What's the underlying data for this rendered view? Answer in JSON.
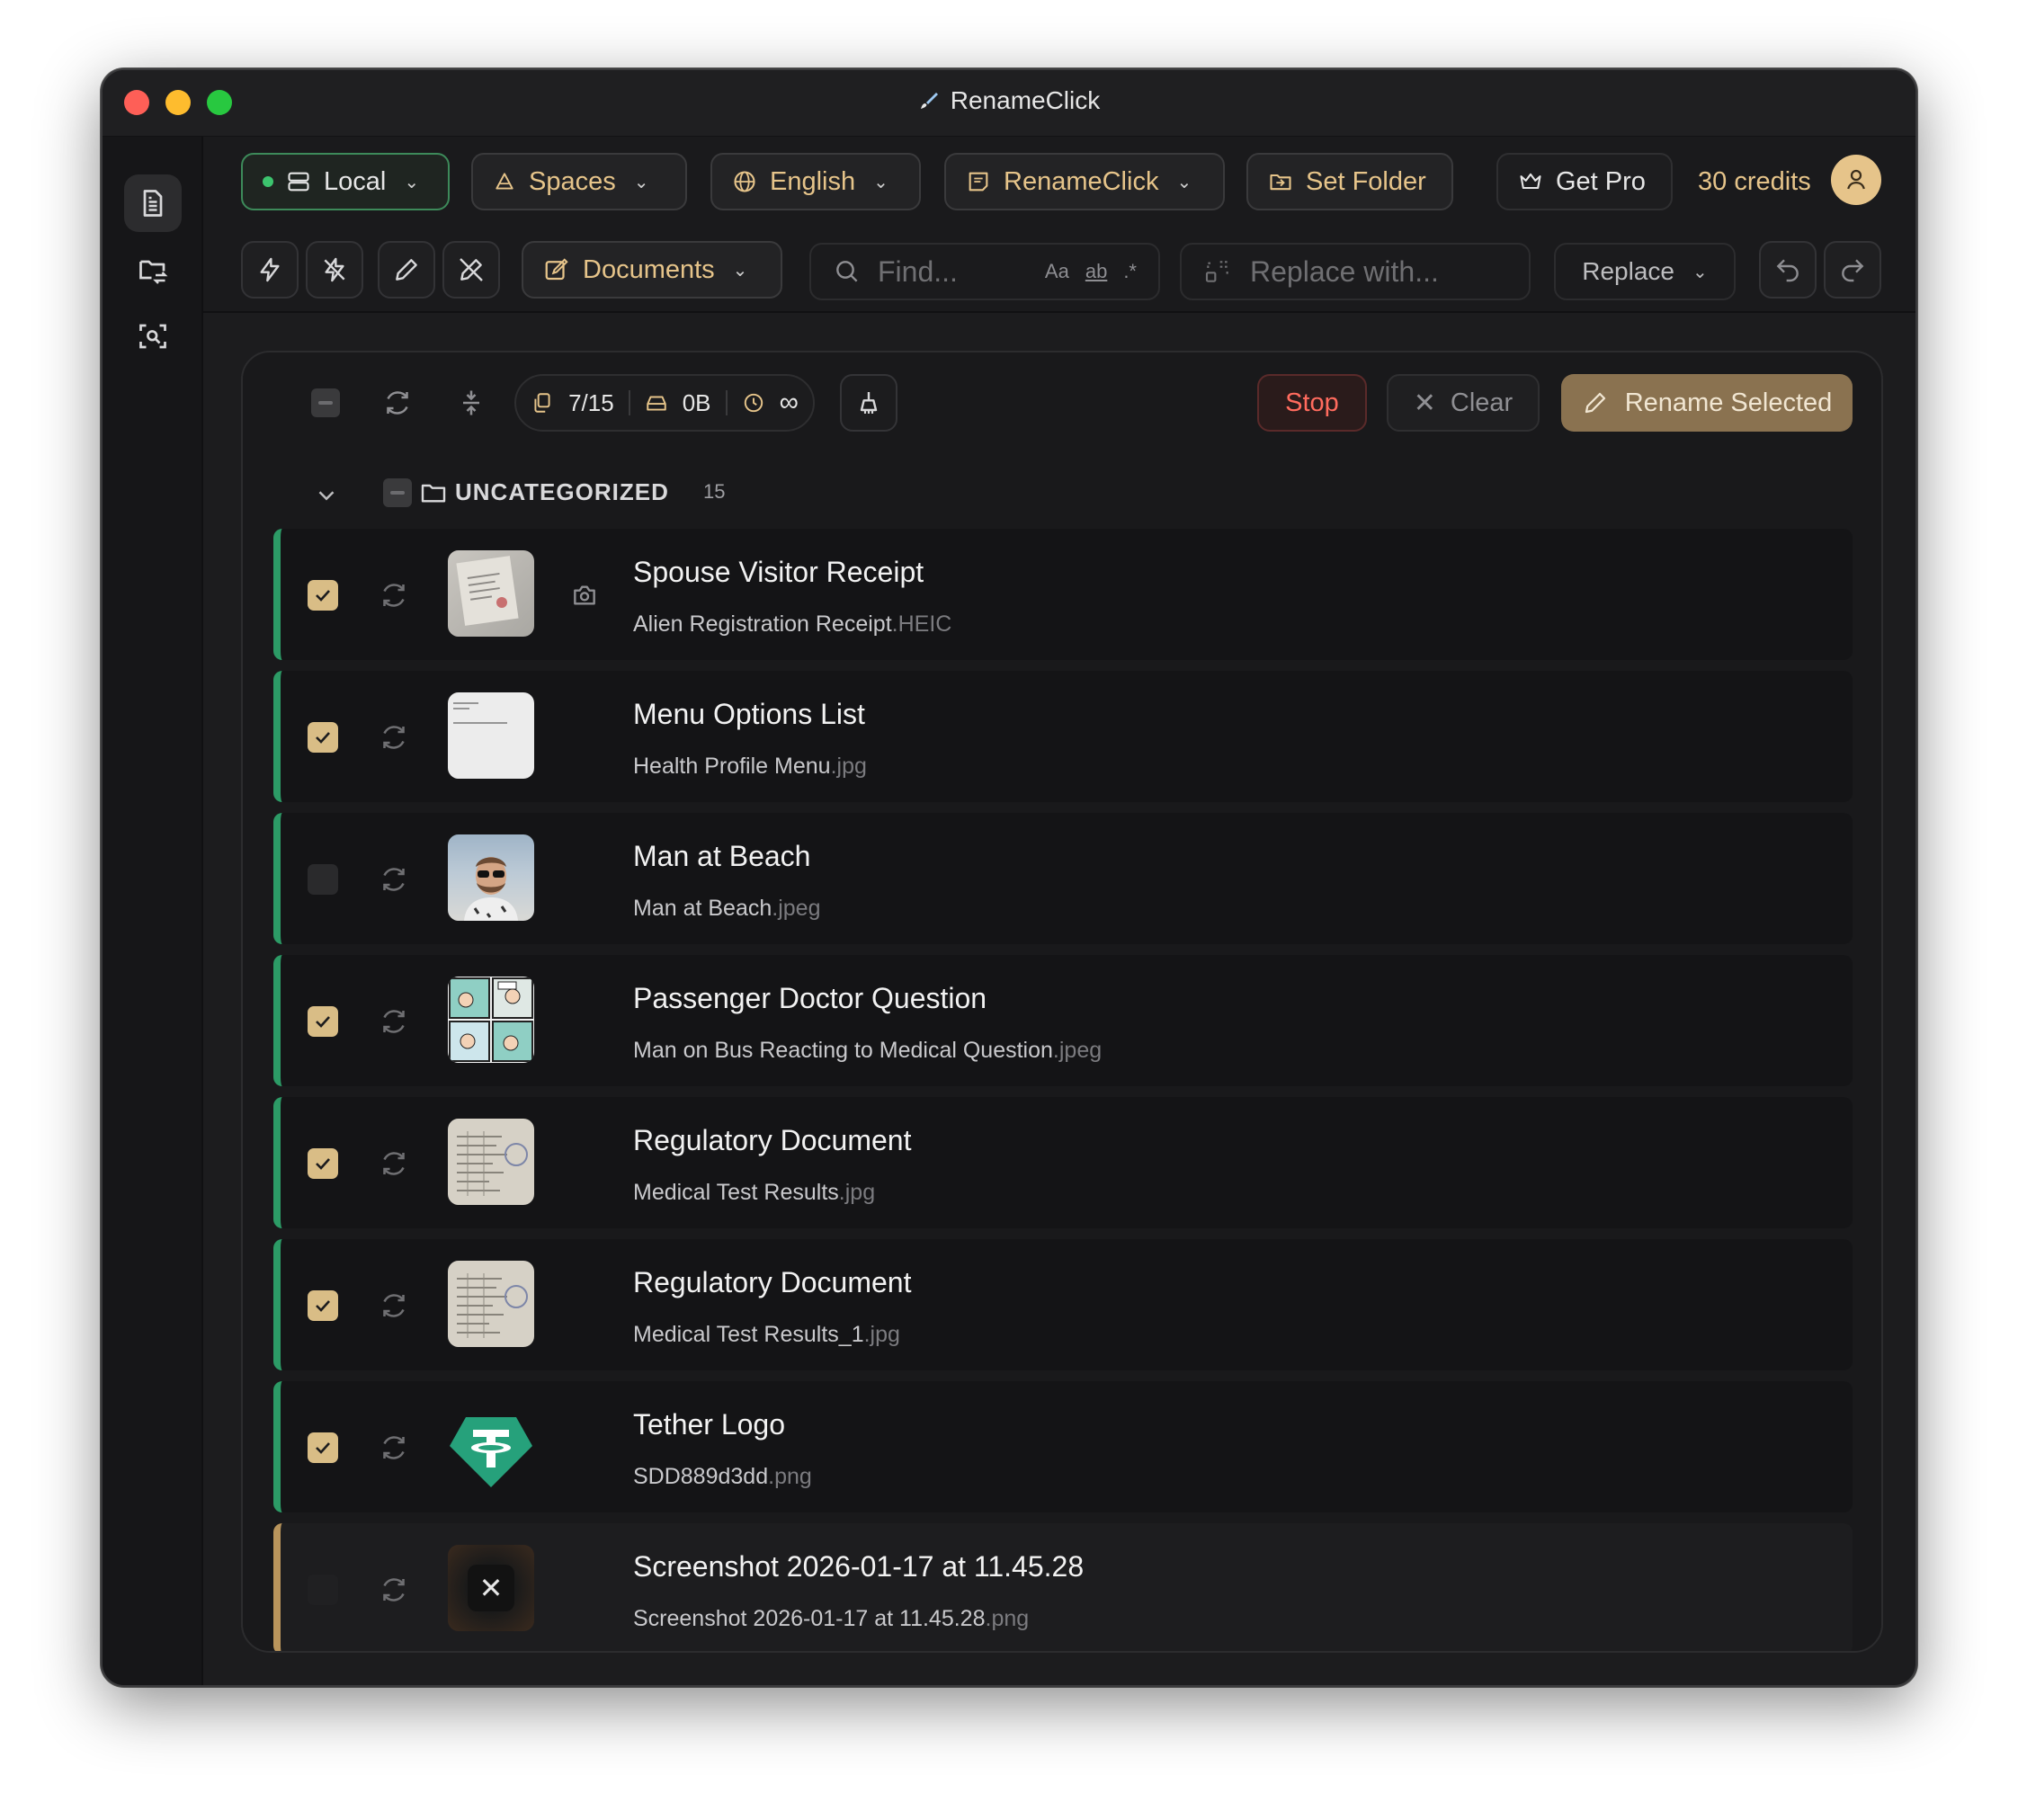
{
  "app": {
    "title": "RenameClick"
  },
  "toolbar": {
    "local_label": "Local",
    "spaces_label": "Spaces",
    "language_label": "English",
    "preset_label": "RenameClick",
    "set_folder_label": "Set Folder",
    "get_pro_label": "Get Pro",
    "credits_text": "30 credits",
    "category_label": "Documents",
    "find_placeholder": "Find...",
    "find_opt_case": "Aa",
    "find_opt_word": "ab",
    "find_opt_regex": ".*",
    "replace_placeholder": "Replace with...",
    "replace_mode": "Replace"
  },
  "panel": {
    "stats_count": "7/15",
    "stats_size": "0B",
    "stats_time": "∞",
    "stop_label": "Stop",
    "clear_label": "Clear",
    "rename_label": "Rename Selected",
    "group": {
      "title": "UNCATEGORIZED",
      "count": "15"
    }
  },
  "files": [
    {
      "name": "Spouse Visitor Receipt",
      "orig_base": "Alien Registration Receipt",
      "orig_ext": ".HEIC",
      "checked": true,
      "thumb": "receipt-photo"
    },
    {
      "name": "Menu Options List",
      "orig_base": "Health Profile Menu",
      "orig_ext": ".jpg",
      "checked": true,
      "thumb": "menu-document"
    },
    {
      "name": "Man at Beach",
      "orig_base": "Man at Beach",
      "orig_ext": ".jpeg",
      "checked": false,
      "thumb": "man-beach-photo"
    },
    {
      "name": "Passenger Doctor Question",
      "orig_base": "Man on Bus Reacting to Medical Question",
      "orig_ext": ".jpeg",
      "checked": true,
      "thumb": "comic-strip"
    },
    {
      "name": "Regulatory Document",
      "orig_base": "Medical Test Results",
      "orig_ext": ".jpg",
      "checked": true,
      "thumb": "stamped-document"
    },
    {
      "name": "Regulatory Document",
      "orig_base": "Medical Test Results_1",
      "orig_ext": ".jpg",
      "checked": true,
      "thumb": "stamped-document"
    },
    {
      "name": "Tether Logo",
      "orig_base": "SDD889d3dd",
      "orig_ext": ".png",
      "checked": true,
      "thumb": "tether-logo"
    },
    {
      "name": "Screenshot 2026-01-17 at 11.45.28",
      "orig_base": "Screenshot 2026-01-17 at 11.45.28",
      "orig_ext": ".png",
      "checked": false,
      "thumb": "close-overlay"
    }
  ],
  "colors": {
    "accent_gold": "#e6c48a",
    "status_green": "#2c9b66",
    "status_pending": "#b9955c",
    "stop_red": "#ff6b5e"
  }
}
